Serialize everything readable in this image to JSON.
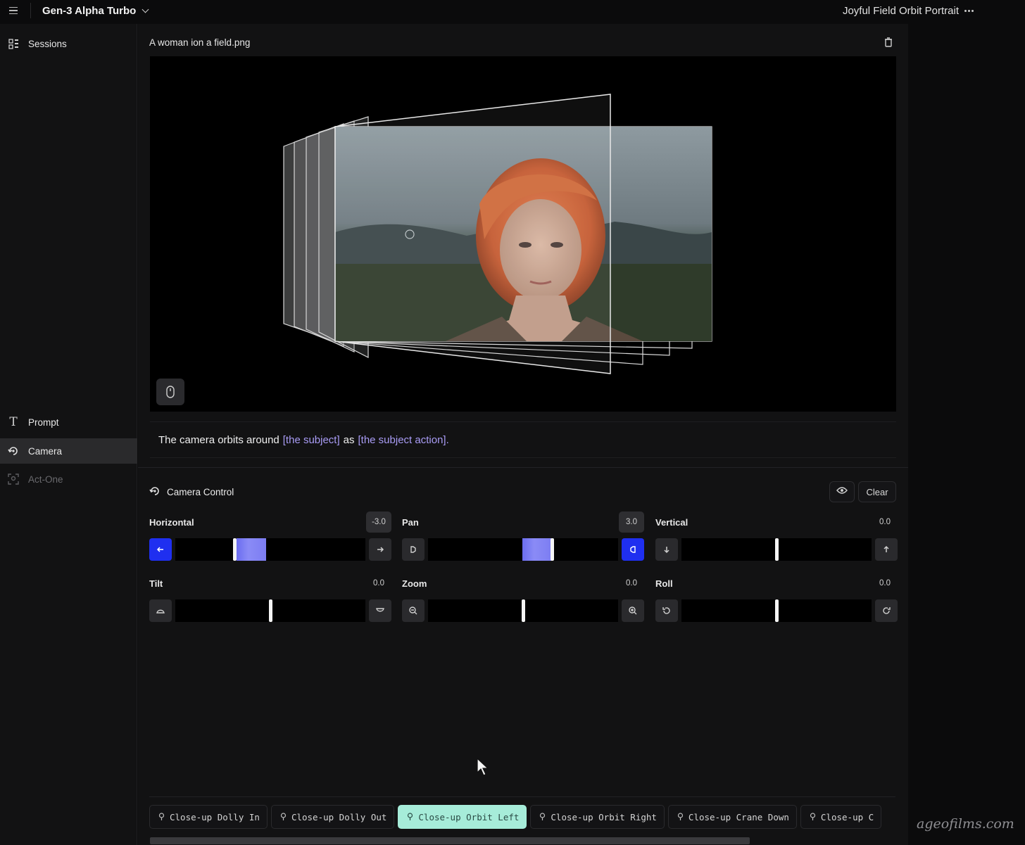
{
  "topbar": {
    "model_label": "Gen-3 Alpha Turbo",
    "project_title": "Joyful Field Orbit Portrait"
  },
  "sidebar": {
    "sessions_label": "Sessions",
    "items": [
      {
        "label": "Prompt",
        "icon": "text-t-icon",
        "active": false
      },
      {
        "label": "Camera",
        "icon": "camera-orbit-icon",
        "active": true
      },
      {
        "label": "Act-One",
        "icon": "face-capture-icon",
        "active": false
      }
    ]
  },
  "preview": {
    "file_name": "A woman ion a field.png"
  },
  "prompt": {
    "text_before": "The camera orbits around",
    "token_subject": "[the subject]",
    "text_middle": "as",
    "token_action": "[the subject action].",
    "accent_color": "#a99cf5"
  },
  "camera_control": {
    "title": "Camera Control",
    "clear_label": "Clear",
    "controls": [
      {
        "label": "Horizontal",
        "value": "-3.0",
        "level": -3.0,
        "range": [
          -10,
          10
        ],
        "left_icon": "arrow-left-icon",
        "right_icon": "arrow-right-icon",
        "active_side": "left"
      },
      {
        "label": "Pan",
        "value": "3.0",
        "level": 3.0,
        "range": [
          -10,
          10
        ],
        "left_icon": "pan-left-icon",
        "right_icon": "pan-right-icon",
        "active_side": "right"
      },
      {
        "label": "Vertical",
        "value": "0.0",
        "level": 0.0,
        "range": [
          -10,
          10
        ],
        "left_icon": "arrow-down-icon",
        "right_icon": "arrow-up-icon",
        "active_side": null
      },
      {
        "label": "Tilt",
        "value": "0.0",
        "level": 0.0,
        "range": [
          -10,
          10
        ],
        "left_icon": "tilt-up-icon",
        "right_icon": "tilt-down-icon",
        "active_side": null
      },
      {
        "label": "Zoom",
        "value": "0.0",
        "level": 0.0,
        "range": [
          -10,
          10
        ],
        "left_icon": "zoom-out-icon",
        "right_icon": "zoom-in-icon",
        "active_side": null
      },
      {
        "label": "Roll",
        "value": "0.0",
        "level": 0.0,
        "range": [
          -10,
          10
        ],
        "left_icon": "rotate-ccw-icon",
        "right_icon": "rotate-cw-icon",
        "active_side": null
      }
    ],
    "active_color": "#1f2ff0",
    "fill_color": "#7c7df2"
  },
  "presets": {
    "items": [
      {
        "label": "Close-up Dolly In",
        "selected": false
      },
      {
        "label": "Close-up Dolly Out",
        "selected": false
      },
      {
        "label": "Close-up Orbit Left",
        "selected": true
      },
      {
        "label": "Close-up Orbit Right",
        "selected": false
      },
      {
        "label": "Close-up Crane Down",
        "selected": false
      },
      {
        "label": "Close-up C",
        "selected": false
      }
    ],
    "selected_color": "#a6ecd9"
  },
  "watermark": "ageofilms.com"
}
